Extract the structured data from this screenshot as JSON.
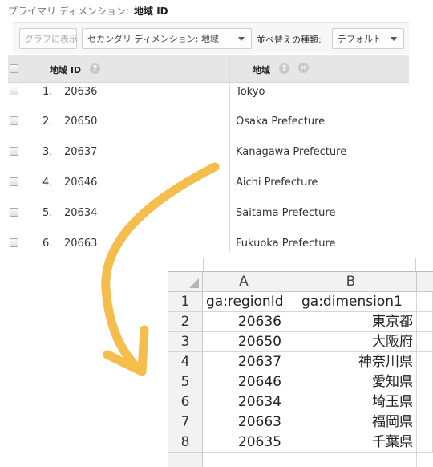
{
  "primary_dimension": {
    "label": "プライマリ ディメンション:",
    "value": "地域 ID"
  },
  "toolbar": {
    "chart_button": "グラフに表示",
    "secondary_dimension": "セカンダリ ディメンション: 地域",
    "sort_label": "並べ替えの種類:",
    "sort_value": "デフォルト"
  },
  "table": {
    "headers": {
      "col1": "地域 ID",
      "col2": "地域"
    },
    "rows": [
      {
        "n": "1.",
        "id": "20636",
        "name": "Tokyo"
      },
      {
        "n": "2.",
        "id": "20650",
        "name": "Osaka Prefecture"
      },
      {
        "n": "3.",
        "id": "20637",
        "name": "Kanagawa Prefecture"
      },
      {
        "n": "4.",
        "id": "20646",
        "name": "Aichi Prefecture"
      },
      {
        "n": "5.",
        "id": "20634",
        "name": "Saitama Prefecture"
      },
      {
        "n": "6.",
        "id": "20663",
        "name": "Fukuoka Prefecture"
      }
    ]
  },
  "colors": {
    "arrow": "#f5bd4b",
    "header_bg": "#e6e6e6",
    "excel_header_bg": "#f2f2f2"
  },
  "spreadsheet": {
    "columns": [
      "A",
      "B"
    ],
    "rows": [
      {
        "n": "1",
        "a": "ga:regionId",
        "b": "ga:dimension1"
      },
      {
        "n": "2",
        "a": "20636",
        "b": "東京都"
      },
      {
        "n": "3",
        "a": "20650",
        "b": "大阪府"
      },
      {
        "n": "4",
        "a": "20637",
        "b": "神奈川県"
      },
      {
        "n": "5",
        "a": "20646",
        "b": "愛知県"
      },
      {
        "n": "6",
        "a": "20634",
        "b": "埼玉県"
      },
      {
        "n": "7",
        "a": "20663",
        "b": "福岡県"
      },
      {
        "n": "8",
        "a": "20635",
        "b": "千葉県"
      }
    ]
  }
}
